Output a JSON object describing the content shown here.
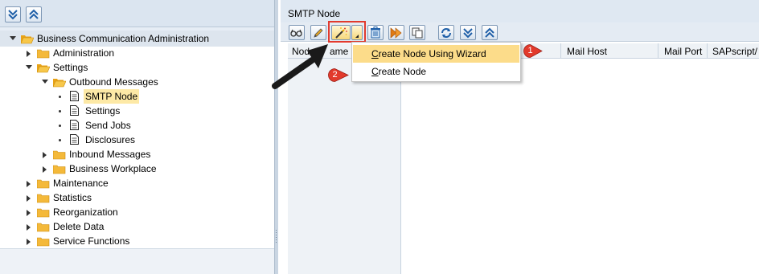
{
  "left_toolbar": {
    "buttons": [
      {
        "name": "expand-all",
        "icon": "expand-all-icon"
      },
      {
        "name": "collapse-all",
        "icon": "collapse-all-icon"
      }
    ]
  },
  "tree": {
    "root": {
      "label": "Business Communication Administration"
    },
    "items": [
      {
        "label": "Administration",
        "type": "folder",
        "expanded": false
      },
      {
        "label": "Settings",
        "type": "folder",
        "expanded": true
      },
      {
        "label": "Outbound Messages",
        "type": "folder",
        "expanded": true
      },
      {
        "label": "SMTP Node",
        "type": "document",
        "selected": true
      },
      {
        "label": "Settings",
        "type": "document"
      },
      {
        "label": "Send Jobs",
        "type": "document"
      },
      {
        "label": "Disclosures",
        "type": "document"
      },
      {
        "label": "Inbound Messages",
        "type": "folder",
        "expanded": false
      },
      {
        "label": "Business Workplace",
        "type": "folder",
        "expanded": false
      },
      {
        "label": "Maintenance",
        "type": "folder",
        "expanded": false
      },
      {
        "label": "Statistics",
        "type": "folder",
        "expanded": false
      },
      {
        "label": "Reorganization",
        "type": "folder",
        "expanded": false
      },
      {
        "label": "Delete Data",
        "type": "folder",
        "expanded": false
      },
      {
        "label": "Service Functions",
        "type": "folder",
        "expanded": false
      }
    ]
  },
  "right_panel": {
    "title": "SMTP Node",
    "toolbar": [
      {
        "name": "display",
        "icon": "glasses-icon"
      },
      {
        "name": "change",
        "icon": "pencil-icon"
      },
      {
        "name": "create",
        "icon": "magic-wand-icon"
      },
      {
        "name": "create-dropdown",
        "icon": "dropdown-arrow-icon"
      },
      {
        "name": "delete",
        "icon": "trash-icon"
      },
      {
        "name": "activate",
        "icon": "forward-icon"
      },
      {
        "name": "copy",
        "icon": "copy-icon"
      },
      {
        "name": "refresh",
        "icon": "refresh-icon"
      },
      {
        "name": "expand",
        "icon": "expand-all-icon"
      },
      {
        "name": "collapse",
        "icon": "collapse-all-icon"
      }
    ],
    "columns": {
      "node_name": "Node Name",
      "node_name_visible": "Nod",
      "node_name_tail": "ame",
      "mail_host": "Mail Host",
      "mail_port": "Mail Port",
      "sapscript": "SAPscript/"
    }
  },
  "context_menu": {
    "items": [
      {
        "label": "Create Node Using Wizard",
        "mnemonic": "C",
        "rest": "reate Node Using Wizard",
        "highlighted": true
      },
      {
        "label": "Create Node",
        "mnemonic": "C",
        "rest": "reate Node",
        "highlighted": false
      }
    ]
  },
  "annotations": {
    "badge_1": "1",
    "badge_2": "2",
    "badge_color": "#e23a2c",
    "highlight_color": "#e13a2e"
  }
}
